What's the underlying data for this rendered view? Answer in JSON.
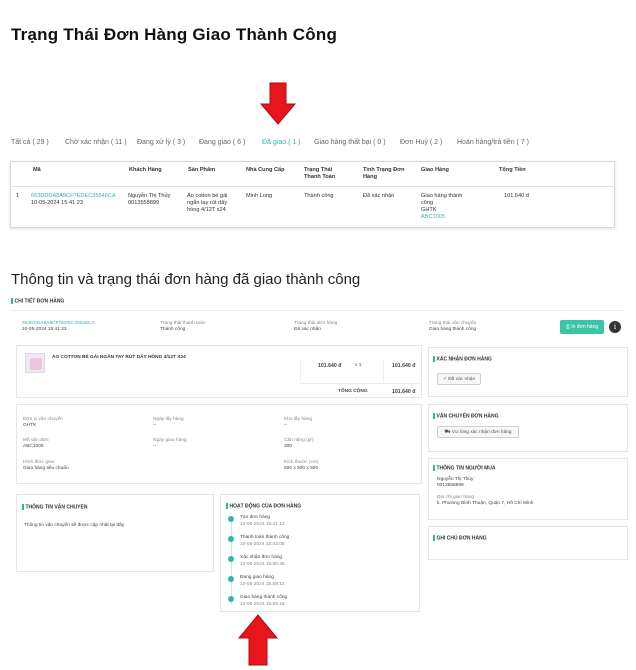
{
  "heading1": "Trạng Thái Đơn Hàng Giao Thành Công",
  "tabs": [
    "Tất cả ( 29 )",
    "Chờ xác nhận ( 11 )",
    "Đang xử lý ( 3 )",
    "Đang giao ( 6 )",
    "Đã giao ( 1 )",
    "Giao hàng thất bại ( 0 )",
    "Đơn Huỷ ( 2 )",
    "Hoàn hàng/trả tiền ( 7 )"
  ],
  "table": {
    "headers": [
      "Mã",
      "Khách Hàng",
      "Sản Phẩm",
      "Nhà Cung Cấp",
      "Trạng Thái\nThanh Toán",
      "Tình Trạng Đơn\nHàng",
      "Giao Hàng",
      "Tổng Tiền"
    ],
    "row": {
      "index": "1",
      "code": "663DDDA8A9CF7EDEC35546CA",
      "date": "10-05-2024 15:41:23",
      "customer_name": "Nguyễn Thị Thủy",
      "customer_phone": "0013558899",
      "product": "Áo cotton bé gái\nngắn tay rút dây\nhồng 4/12T x24",
      "supplier": "Minh Long",
      "payment_status": "Thành công",
      "order_status": "Đã xác nhận",
      "delivery_status": "Giao hàng thành\ncông",
      "carrier": "GHTK",
      "tracking": "ABC1005",
      "total": "101.640 đ"
    }
  },
  "heading2": "Thông tin và trạng thái đơn hàng đã giao thành công",
  "detail": {
    "title": "CHI TIẾT ĐƠN HÀNG",
    "code": "663DDDA8A9CF7EDEC35546CA",
    "date": "10-05-2024 15:41:23",
    "payment_label": "Trạng thái thanh toán",
    "payment_value": "Thành công",
    "order_label": "Trạng thái đơn hàng",
    "order_value": "Đã xác nhận",
    "shipping_label": "Trạng thái vận chuyển",
    "shipping_value": "Giao hàng thành công",
    "print_button": "In đơn hàng",
    "product_name": "ÁO COTTON BÉ GÁI NGẮN TAY RÚT DÂY HỒNG 4/12T X24",
    "unit_price": "101.640 đ",
    "qty": "x 1",
    "line_total": "101.640 đ",
    "sum_label": "TỔNG CỘNG",
    "sum_value": "101.640 đ",
    "confirm_title": "XÁC NHẬN ĐƠN HÀNG",
    "confirm_button": "Đã xác nhận",
    "ship_title": "VẬN CHUYỂN ĐƠN HÀNG",
    "ship_button": "Vui lòng xác nhận đơn hàng",
    "buyer_title": "THÔNG TIN NGƯỜI MUA",
    "buyer_name": "Nguyễn Thị Thủy",
    "buyer_phone": "0013558899",
    "buyer_addr_label": "Địa chỉ giao hàng",
    "buyer_addr": "k. Phường Bình Thuận, Quận 7, Hồ Chí Minh",
    "note_title": "GHI CHÚ ĐƠN HÀNG",
    "fields": {
      "carrier_label": "Đơn vị vận chuyển",
      "carrier": "GHTK",
      "pickup_label": "Ngày lấy hàng",
      "pickup": "--",
      "warehouse_label": "Kho lấy hàng",
      "warehouse": "--",
      "code_label": "Mã vận đơn",
      "code": "ABC1005",
      "delivery_label": "Ngày giao hàng",
      "delivery": "--",
      "weight_label": "Cân nặng (gr)",
      "weight": "300",
      "form_label": "Hình thức giao",
      "form": "Giao hàng tiêu chuẩn",
      "size_label": "Kích thước (cm)",
      "size": "500 x 500 x 500"
    },
    "shipinfo_title": "THÔNG TIN VẬN CHUYỂN",
    "shipinfo_text": "Thông tin vận chuyển sẽ được cập nhật tại đây",
    "activity_title": "HOẠT ĐỘNG CỦA ĐƠN HÀNG",
    "activity": [
      {
        "label": "Tạo đơn hàng",
        "time": "10-05-2024 15:41:12"
      },
      {
        "label": "Thanh toán thành công",
        "time": "10-05-2024 15:43:05"
      },
      {
        "label": "Xác nhận đơn hàng",
        "time": "10-05-2024 15:50:46"
      },
      {
        "label": "Đang giao hàng",
        "time": "10-05-2024 15:59:12"
      },
      {
        "label": "Giao hàng thành công",
        "time": "10-05-2024 15:59:16"
      }
    ]
  },
  "colors": {
    "accent": "#2eb8a6",
    "arrow": "#e8161c"
  }
}
